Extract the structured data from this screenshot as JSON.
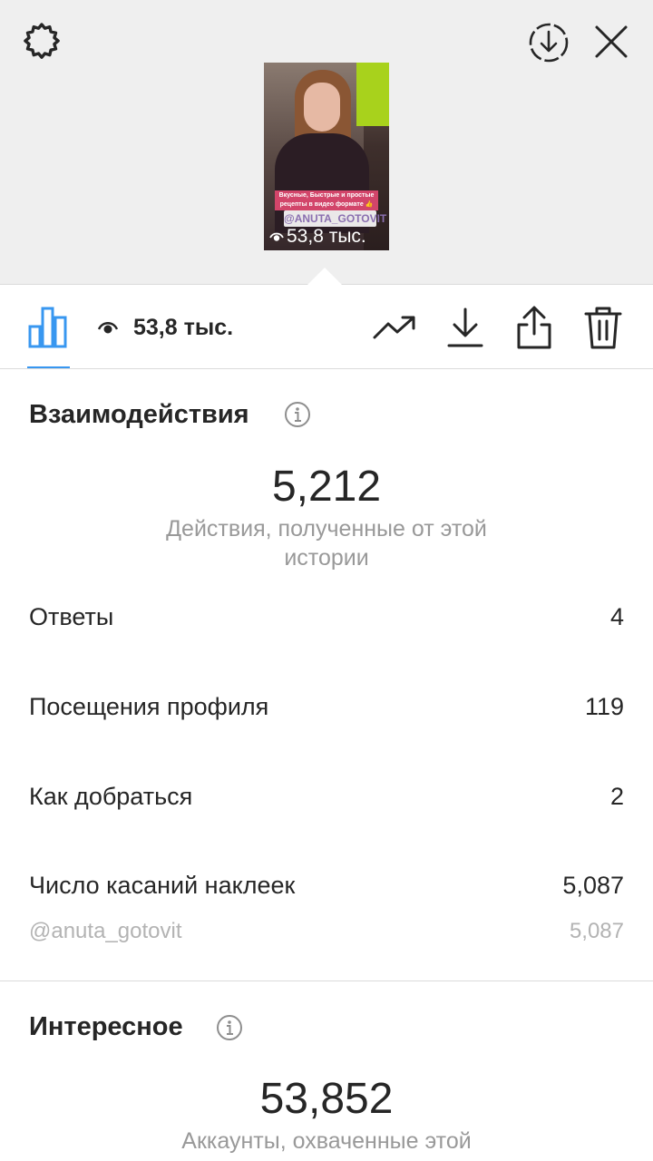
{
  "header": {
    "settings_icon": "gear-icon",
    "download_icon": "download-circle-icon",
    "close_icon": "close-icon"
  },
  "story_preview": {
    "caption": "Вкусные, Быстрые и простые рецепты в видео формате 👍",
    "mention": "@ANUTA_GOTOVIT",
    "views": "53,8 тыс."
  },
  "toolbar": {
    "viewers": "53,8 тыс.",
    "active_color": "#3897f0",
    "icons": [
      "insights-icon",
      "eye-icon",
      "trending-icon",
      "download-icon",
      "share-icon",
      "trash-icon"
    ]
  },
  "interactions": {
    "title": "Взаимодействия",
    "total": "5,212",
    "subtitle": "Действия, полученные от этой истории",
    "rows": [
      {
        "label": "Ответы",
        "value": "4"
      },
      {
        "label": "Посещения профиля",
        "value": "119"
      },
      {
        "label": "Как добраться",
        "value": "2"
      },
      {
        "label": "Число касаний наклеек",
        "value": "5,087"
      }
    ],
    "sub_row": {
      "label": "@anuta_gotovit",
      "value": "5,087"
    }
  },
  "discovery": {
    "title": "Интересное",
    "total": "53,852",
    "subtitle": "Аккаунты, охваченные этой"
  }
}
